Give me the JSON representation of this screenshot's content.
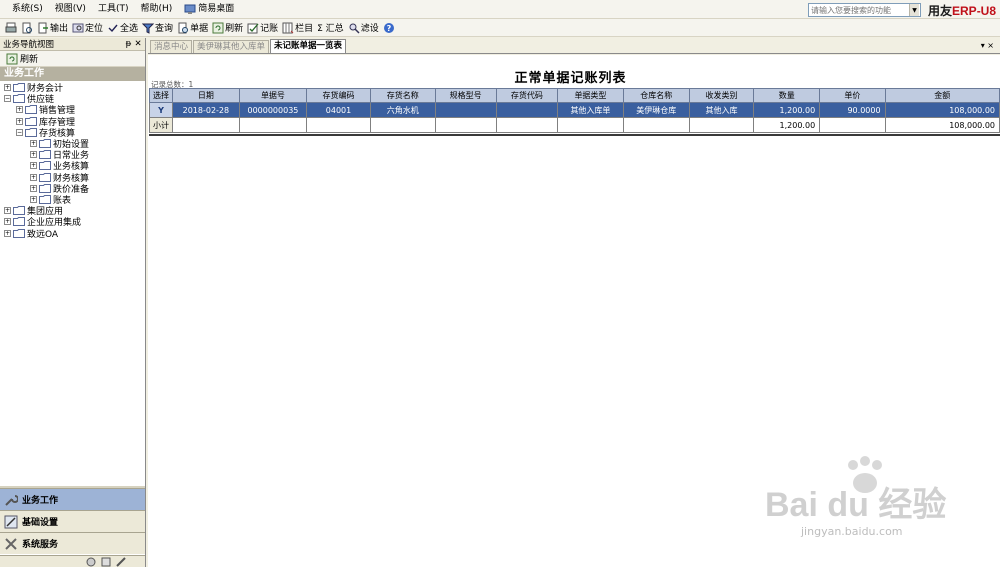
{
  "menu": [
    {
      "label": "系统(S)"
    },
    {
      "label": "视图(V)"
    },
    {
      "label": "工具(T)"
    },
    {
      "label": "帮助(H)"
    }
  ],
  "simple_desktop": "简易桌面",
  "search": {
    "placeholder": "请输入您要搜索的功能"
  },
  "brand": {
    "prefix": "用友",
    "erp": "ERP-U8"
  },
  "toolbar": {
    "output": "输出",
    "locate": "定位",
    "select_all": "全选",
    "query": "查询",
    "document": "单据",
    "refresh": "刷新",
    "post": "记账",
    "columns": "栏目",
    "summary": "Σ 汇总",
    "filter": "滤设"
  },
  "left_pane": {
    "title": "业务导航视图",
    "pin": "ᵽ",
    "close": "✕",
    "refresh": "刷新",
    "header": "业务工作",
    "tree": [
      {
        "label": "财务会计",
        "level": 0,
        "sign": "+"
      },
      {
        "label": "供应链",
        "level": 0,
        "sign": "−"
      },
      {
        "label": "销售管理",
        "level": 1,
        "sign": "+"
      },
      {
        "label": "库存管理",
        "level": 1,
        "sign": "+"
      },
      {
        "label": "存货核算",
        "level": 1,
        "sign": "−"
      },
      {
        "label": "初始设置",
        "level": 2,
        "sign": "+"
      },
      {
        "label": "日常业务",
        "level": 2,
        "sign": "+"
      },
      {
        "label": "业务核算",
        "level": 2,
        "sign": "+"
      },
      {
        "label": "财务核算",
        "level": 2,
        "sign": "+"
      },
      {
        "label": "跌价准备",
        "level": 2,
        "sign": "+"
      },
      {
        "label": "账表",
        "level": 2,
        "sign": "+"
      },
      {
        "label": "集团应用",
        "level": 0,
        "sign": "+"
      },
      {
        "label": "企业应用集成",
        "level": 0,
        "sign": "+"
      },
      {
        "label": "致远OA",
        "level": 0,
        "sign": "+"
      }
    ],
    "nav_buttons": [
      {
        "label": "业务工作",
        "active": true
      },
      {
        "label": "基础设置",
        "active": false
      },
      {
        "label": "系统服务",
        "active": false
      }
    ]
  },
  "tabs": [
    {
      "label": "消息中心",
      "active": false
    },
    {
      "label": "美伊琳其他入库单",
      "active": false
    },
    {
      "label": "未记账单据一览表",
      "active": true
    }
  ],
  "tab_menu": "▾ ×",
  "report": {
    "title": "正常单据记账列表",
    "record_count": "记录总数：1",
    "columns": [
      "选择",
      "日期",
      "单据号",
      "存货编码",
      "存货名称",
      "规格型号",
      "存货代码",
      "单据类型",
      "仓库名称",
      "收发类别",
      "数量",
      "单价",
      "金额"
    ],
    "rows": [
      [
        "Y",
        "2018-02-28",
        "0000000035",
        "04001",
        "六角水机",
        "",
        "",
        "其他入库单",
        "美伊琳仓库",
        "其他入库",
        "1,200.00",
        "90.0000",
        "108,000.00"
      ]
    ],
    "subtotal": [
      "小计",
      "",
      "",
      "",
      "",
      "",
      "",
      "",
      "",
      "",
      "1,200.00",
      "",
      "108,000.00"
    ]
  },
  "watermark": {
    "logo": "Bai du 经验",
    "url": "jingyan.baidu.com"
  }
}
